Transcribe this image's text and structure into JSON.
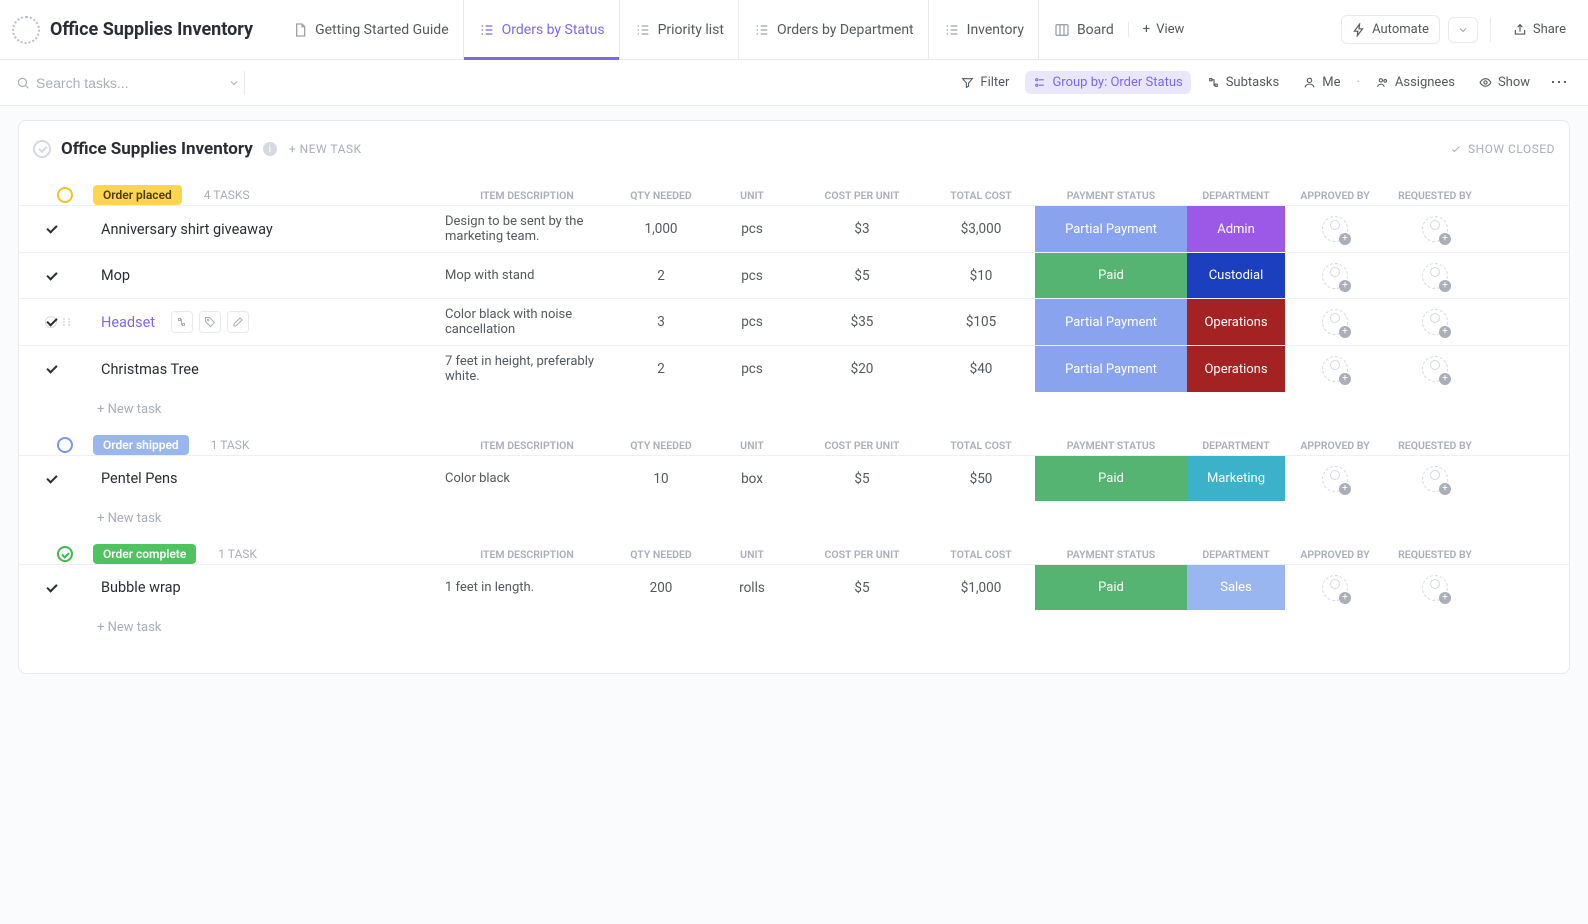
{
  "app_title": "Office Supplies Inventory",
  "tabs": [
    {
      "label": "Getting Started Guide"
    },
    {
      "label": "Orders by Status"
    },
    {
      "label": "Priority list"
    },
    {
      "label": "Orders by Department"
    },
    {
      "label": "Inventory"
    },
    {
      "label": "Board"
    }
  ],
  "add_view_label": "View",
  "automate_label": "Automate",
  "share_label": "Share",
  "search_placeholder": "Search tasks...",
  "toolbar": {
    "filter": "Filter",
    "group_by": "Group by: Order Status",
    "subtasks": "Subtasks",
    "me": "Me",
    "assignees": "Assignees",
    "show": "Show"
  },
  "sheet_title": "Office Supplies Inventory",
  "new_task_label": "+ NEW TASK",
  "show_closed_label": "SHOW CLOSED",
  "new_task_row": "+ New task",
  "columns": {
    "item_desc": "ITEM DESCRIPTION",
    "qty": "QTY NEEDED",
    "unit": "UNIT",
    "cpu": "COST PER UNIT",
    "total": "TOTAL COST",
    "pay": "PAYMENT STATUS",
    "dept": "DEPARTMENT",
    "approved": "APPROVED BY",
    "requested": "REQUESTED BY"
  },
  "groups": [
    {
      "status": "Order placed",
      "count": "4 TASKS",
      "pill_bg": "#ffd54f",
      "pill_fg": "#4a3b00",
      "circle": "#f0c420",
      "rows": [
        {
          "name": "Anniversary shirt giveaway",
          "link": false,
          "desc": "Design to be sent by the marketing team.",
          "qty": "1,000",
          "unit": "pcs",
          "cpu": "$3",
          "total": "$3,000",
          "pay": "Partial Payment",
          "pay_bg": "#8aa3ef",
          "dept": "Admin",
          "dept_bg": "#9b59e6",
          "hover": false
        },
        {
          "name": "Mop",
          "link": false,
          "desc": "Mop with stand",
          "qty": "2",
          "unit": "pcs",
          "cpu": "$5",
          "total": "$10",
          "pay": "Paid",
          "pay_bg": "#55b471",
          "dept": "Custodial",
          "dept_bg": "#1b3fbf",
          "hover": false
        },
        {
          "name": "Headset",
          "link": true,
          "desc": "Color black with noise cancellation",
          "qty": "3",
          "unit": "pcs",
          "cpu": "$35",
          "total": "$105",
          "pay": "Partial Payment",
          "pay_bg": "#8aa3ef",
          "dept": "Operations",
          "dept_bg": "#a52222",
          "hover": true
        },
        {
          "name": "Christmas Tree",
          "link": false,
          "desc": "7 feet in height, preferably white.",
          "qty": "2",
          "unit": "pcs",
          "cpu": "$20",
          "total": "$40",
          "pay": "Partial Payment",
          "pay_bg": "#8aa3ef",
          "dept": "Operations",
          "dept_bg": "#a52222",
          "hover": false
        }
      ]
    },
    {
      "status": "Order shipped",
      "count": "1 TASK",
      "pill_bg": "#9ab6f0",
      "pill_fg": "#fff",
      "circle": "#7b96e8",
      "rows": [
        {
          "name": "Pentel Pens",
          "link": false,
          "desc": "Color black",
          "qty": "10",
          "unit": "box",
          "cpu": "$5",
          "total": "$50",
          "pay": "Paid",
          "pay_bg": "#55b471",
          "dept": "Marketing",
          "dept_bg": "#3bb2c9",
          "hover": false
        }
      ]
    },
    {
      "status": "Order complete",
      "count": "1 TASK",
      "pill_bg": "#4fc360",
      "pill_fg": "#fff",
      "circle": "#3fb851",
      "rows": [
        {
          "name": "Bubble wrap",
          "link": false,
          "desc": "1 feet in length.",
          "qty": "200",
          "unit": "rolls",
          "cpu": "$5",
          "total": "$1,000",
          "pay": "Paid",
          "pay_bg": "#55b471",
          "dept": "Sales",
          "dept_bg": "#9ab6f0",
          "hover": false
        }
      ]
    }
  ]
}
